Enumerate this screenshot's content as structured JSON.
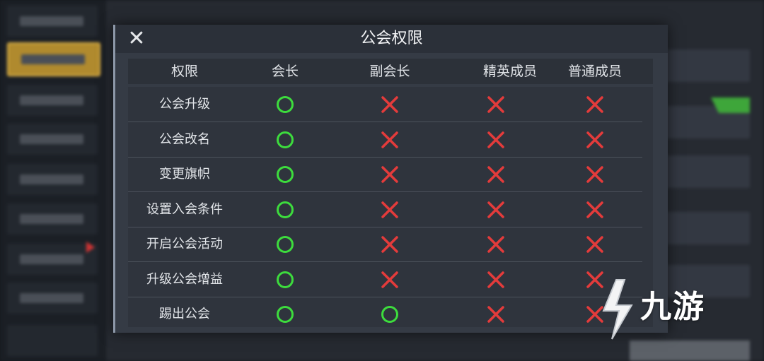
{
  "dialog": {
    "title": "公会权限",
    "close_glyph": "✕"
  },
  "table": {
    "headers": [
      "权限",
      "会长",
      "副会长",
      "精英成员",
      "普通成员"
    ],
    "rows": [
      {
        "label": "公会升级",
        "cells": [
          "yes",
          "no",
          "no",
          "no"
        ]
      },
      {
        "label": "公会改名",
        "cells": [
          "yes",
          "no",
          "no",
          "no"
        ]
      },
      {
        "label": "变更旗帜",
        "cells": [
          "yes",
          "no",
          "no",
          "no"
        ]
      },
      {
        "label": "设置入会条件",
        "cells": [
          "yes",
          "no",
          "no",
          "no"
        ]
      },
      {
        "label": "开启公会活动",
        "cells": [
          "yes",
          "no",
          "no",
          "no"
        ]
      },
      {
        "label": "升级公会增益",
        "cells": [
          "yes",
          "no",
          "no",
          "no"
        ]
      },
      {
        "label": "踢出公会",
        "cells": [
          "yes",
          "yes",
          "no",
          "no"
        ]
      }
    ],
    "legend": {
      "yes": "green-circle-icon",
      "no": "red-cross-icon"
    },
    "colors": {
      "yes": "#3ddc3d",
      "no": "#e43b3b"
    }
  },
  "watermark": {
    "text": "九游"
  }
}
